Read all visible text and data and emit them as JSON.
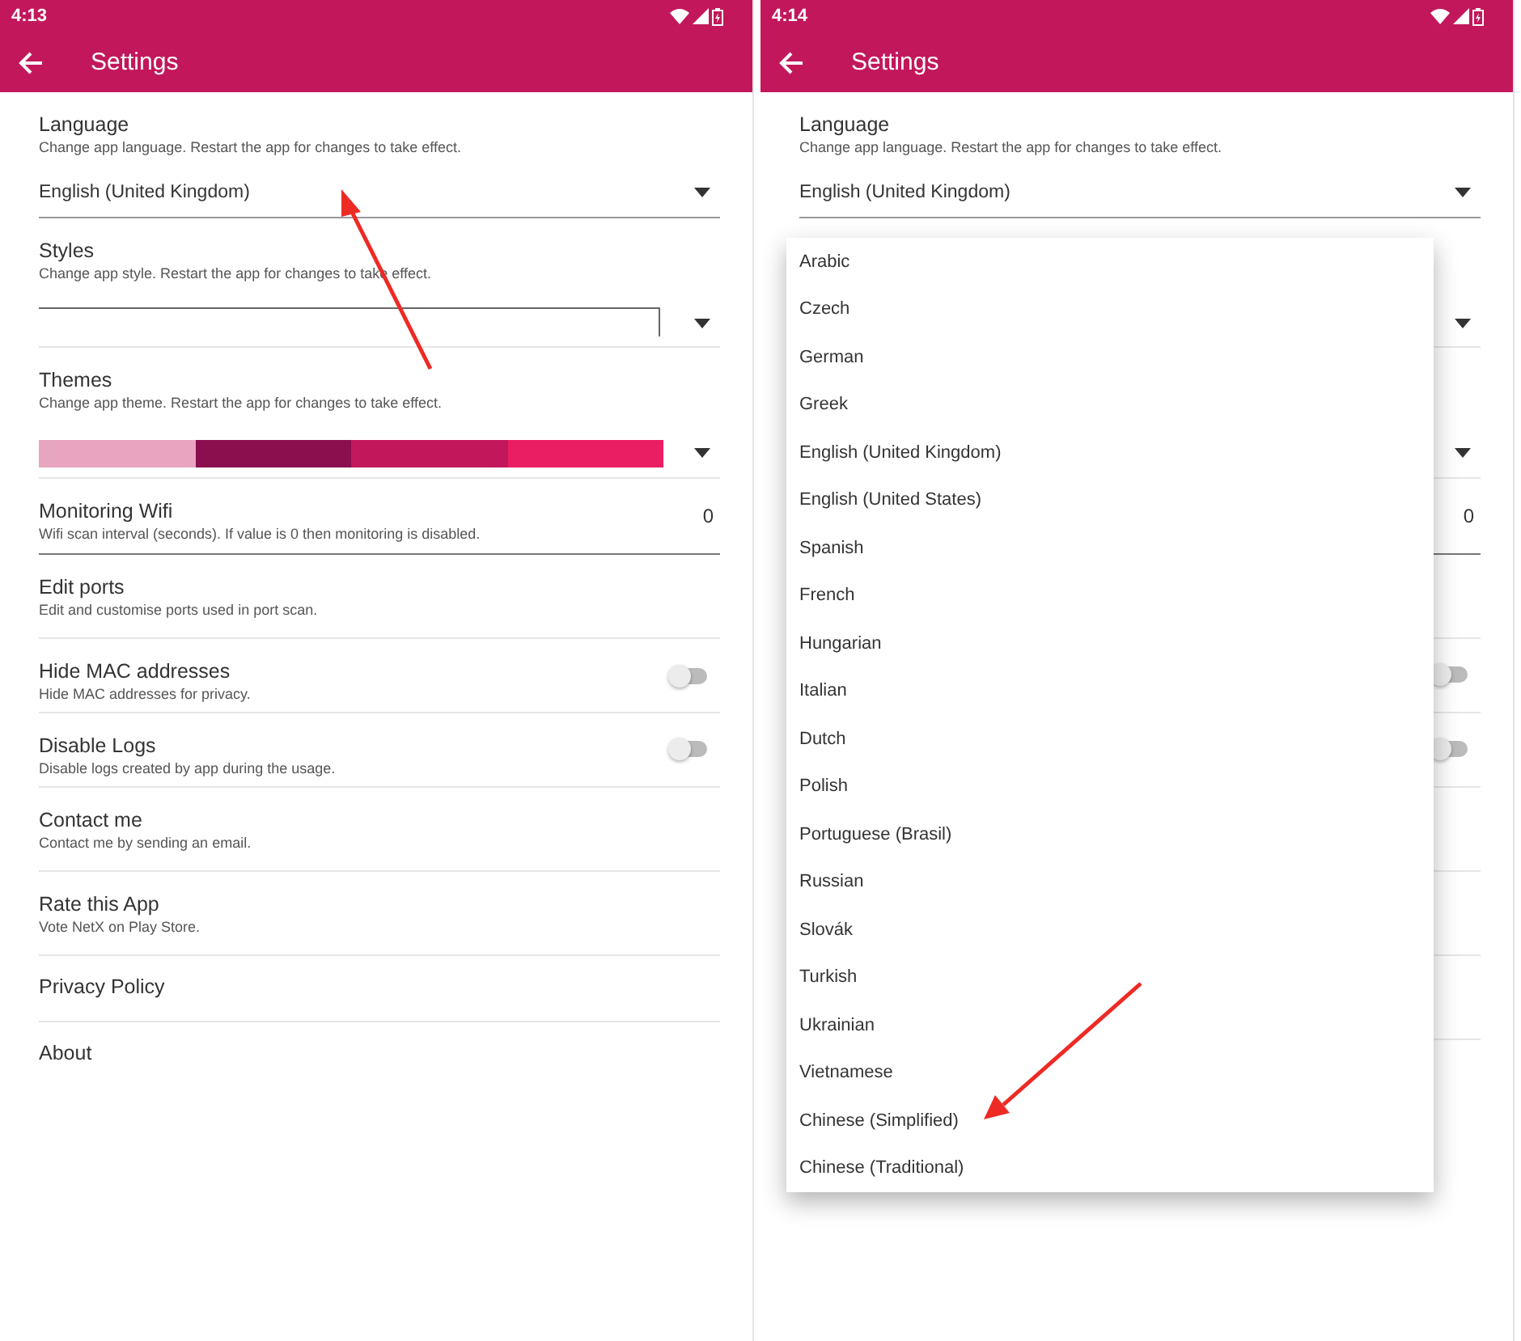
{
  "phones": [
    {
      "status_bar": {
        "time": "4:13"
      },
      "app_bar": {
        "title": "Settings"
      },
      "settings": [
        {
          "kind": "dropdown",
          "title": "Language",
          "subtitle": "Change app language. Restart the app for changes to take effect.",
          "value": "English (United Kingdom)"
        },
        {
          "kind": "style-dropdown",
          "title": "Styles",
          "subtitle": "Change app style. Restart the app for changes to take effect."
        },
        {
          "kind": "theme",
          "title": "Themes",
          "subtitle": "Change app theme. Restart the app for changes to take effect.",
          "swatches": [
            {
              "color": "#e8a5c0"
            },
            {
              "color": "#8b0e4e"
            },
            {
              "color": "#c2185b"
            },
            {
              "color": "#e91e63"
            }
          ]
        },
        {
          "kind": "value",
          "title": "Monitoring Wifi",
          "subtitle": "Wifi scan interval (seconds). If value is 0 then monitoring is disabled.",
          "value": "0"
        },
        {
          "kind": "plain",
          "title": "Edit ports",
          "subtitle": "Edit and customise ports used in port scan."
        },
        {
          "kind": "switch",
          "title": "Hide MAC addresses",
          "subtitle": "Hide MAC addresses for privacy.",
          "on": false
        },
        {
          "kind": "switch",
          "title": "Disable Logs",
          "subtitle": "Disable logs created by app during the usage.",
          "on": false
        },
        {
          "kind": "plain",
          "title": "Contact me",
          "subtitle": "Contact me by sending an email."
        },
        {
          "kind": "plain",
          "title": "Rate this App",
          "subtitle": "Vote NetX on Play Store."
        },
        {
          "kind": "plain",
          "title": "Privacy Policy"
        },
        {
          "kind": "plain",
          "title": "About"
        }
      ],
      "annotations": [
        {
          "kind": "arrow-up"
        }
      ]
    },
    {
      "status_bar": {
        "time": "4:14"
      },
      "app_bar": {
        "title": "Settings"
      },
      "settings": [
        {
          "kind": "dropdown",
          "title": "Language",
          "subtitle": "Change app language. Restart the app for changes to take effect.",
          "value": "English (United Kingdom)"
        },
        {
          "kind": "style-dropdown"
        },
        {
          "kind": "theme"
        },
        {
          "kind": "value",
          "value": "0"
        },
        {
          "kind": "plain"
        },
        {
          "kind": "switch",
          "on": false
        },
        {
          "kind": "switch",
          "on": false
        },
        {
          "kind": "plain"
        },
        {
          "kind": "plain"
        },
        {
          "kind": "plain"
        },
        {
          "kind": "plain"
        }
      ],
      "menu": [
        "Arabic",
        "Czech",
        "German",
        "Greek",
        "English (United Kingdom)",
        "English (United States)",
        "Spanish",
        "French",
        "Hungarian",
        "Italian",
        "Dutch",
        "Polish",
        "Portuguese (Brasil)",
        "Russian",
        "Slovák",
        "Turkish",
        "Ukrainian",
        "Vietnamese",
        "Chinese (Simplified)",
        "Chinese (Traditional)"
      ],
      "annotations": [
        {
          "kind": "arrow-down-left"
        }
      ]
    }
  ]
}
